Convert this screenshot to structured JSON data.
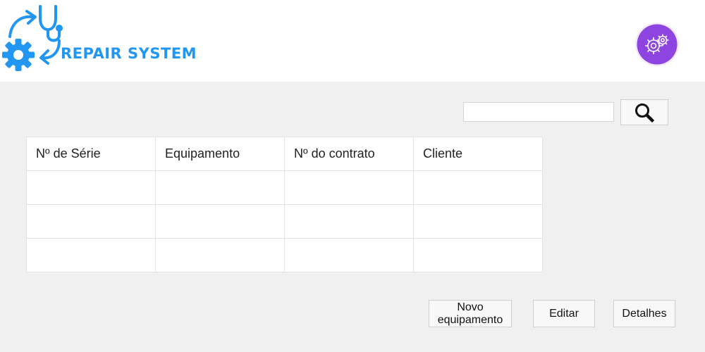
{
  "header": {
    "logo_text": "REPAIR SYSTEM",
    "logo_color": "#2196f3",
    "settings_icon": "gears-icon",
    "settings_color": "#8e44e0"
  },
  "search": {
    "value": "",
    "placeholder": "",
    "button_icon": "magnifier-icon"
  },
  "table": {
    "columns": [
      "Nº de Série",
      "Equipamento",
      "Nº do contrato",
      "Cliente"
    ],
    "rows": [
      [
        "",
        "",
        "",
        ""
      ],
      [
        "",
        "",
        "",
        ""
      ],
      [
        "",
        "",
        "",
        ""
      ]
    ]
  },
  "actions": {
    "new_label": "Novo equipamento",
    "edit_label": "Editar",
    "details_label": "Detalhes"
  }
}
